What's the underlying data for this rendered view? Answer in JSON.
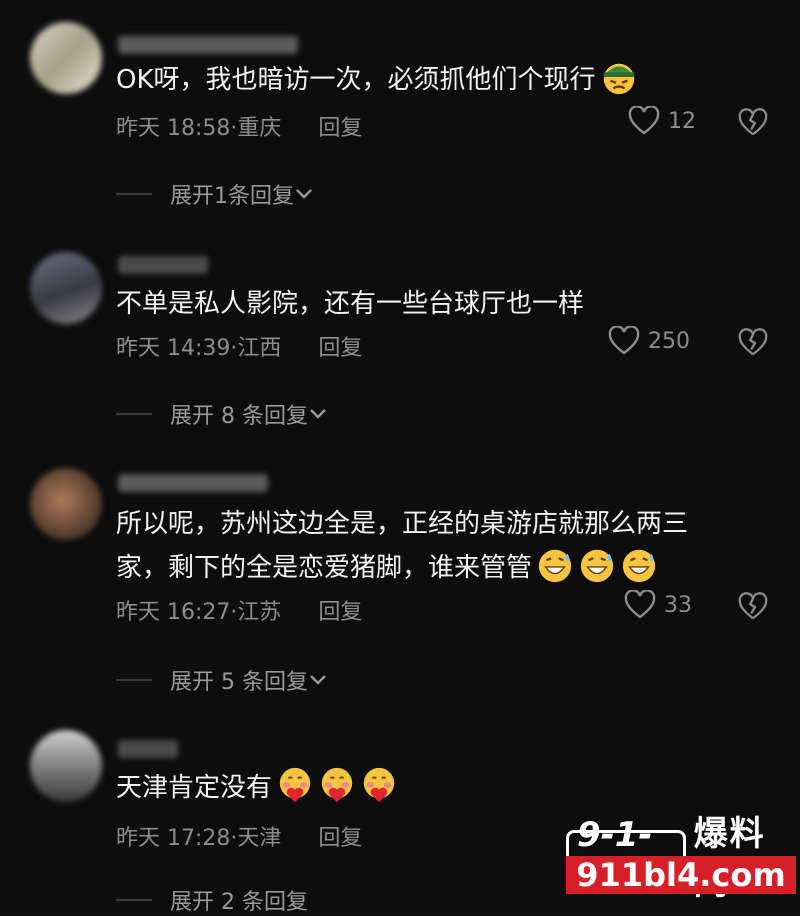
{
  "comments": [
    {
      "text": "OK呀，我也暗访一次，必须抓他们个现行",
      "emoji_count": 1,
      "emoji_icon": "angry-green-cap-emoji",
      "time": "昨天 18:58",
      "location": "重庆",
      "reply_label": "回复",
      "likes": "12",
      "expand_label": "展开1条回复"
    },
    {
      "text": "不单是私人影院，还有一些台球厅也一样",
      "emoji_count": 0,
      "time": "昨天 14:39",
      "location": "江西",
      "reply_label": "回复",
      "likes": "250",
      "expand_label": "展开 8 条回复"
    },
    {
      "text_line1": "所以呢，苏州这边全是，正经的桌游店就那么两三",
      "text_line2": "家，剩下的全是恋爱猪脚，谁来管管",
      "emoji_count": 3,
      "emoji_icon": "grinning-sweat-emoji",
      "time": "昨天 16:27",
      "location": "江苏",
      "reply_label": "回复",
      "likes": "33",
      "expand_label": "展开 5 条回复"
    },
    {
      "text": "天津肯定没有",
      "emoji_count": 3,
      "emoji_icon": "heart-hug-emoji",
      "time": "昨天 17:28",
      "location": "天津",
      "reply_label": "回复",
      "expand_label": "展开 2 条回复"
    }
  ],
  "watermark": {
    "logo": "9-1-1",
    "title": "爆料网",
    "url": "911bl4.com"
  },
  "colors": {
    "background": "#0d0d0d",
    "text": "#f2f2f2",
    "meta": "#8d8d8d",
    "watermark_red": "#d61f26"
  }
}
